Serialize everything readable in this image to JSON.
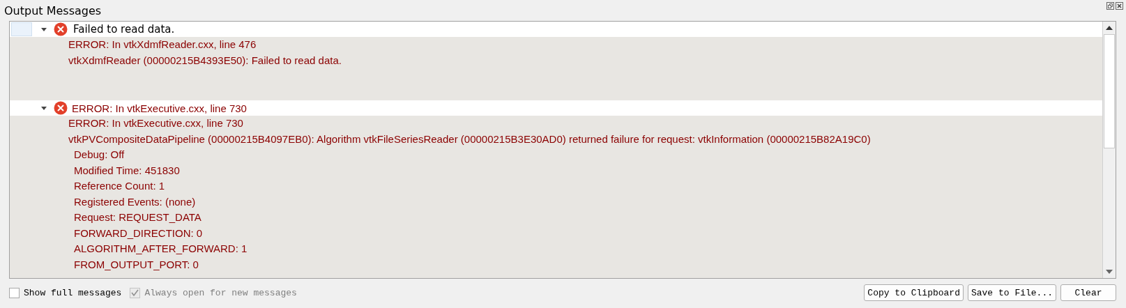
{
  "window": {
    "title": "Output Messages"
  },
  "messages": [
    {
      "title": "Failed to read data.",
      "expanded": true,
      "selected": true,
      "lines": [
        {
          "kind": "line",
          "text": "ERROR: In vtkXdmfReader.cxx, line 476"
        },
        {
          "kind": "line",
          "text": "vtkXdmfReader (00000215B4393E50): Failed to read data."
        }
      ]
    },
    {
      "title": "ERROR: In vtkExecutive.cxx, line 730",
      "expanded": true,
      "selected": false,
      "lines": [
        {
          "kind": "line",
          "text": "ERROR: In vtkExecutive.cxx, line 730"
        },
        {
          "kind": "line",
          "text": "vtkPVCompositeDataPipeline (00000215B4097EB0): Algorithm vtkFileSeriesReader (00000215B3E30AD0) returned failure for request: vtkInformation (00000215B82A19C0)"
        },
        {
          "kind": "property",
          "text": "Debug: Off"
        },
        {
          "kind": "property",
          "text": "Modified Time: 451830"
        },
        {
          "kind": "property",
          "text": "Reference Count: 1"
        },
        {
          "kind": "property",
          "text": "Registered Events: (none)"
        },
        {
          "kind": "property",
          "text": "Request: REQUEST_DATA"
        },
        {
          "kind": "property",
          "text": "FORWARD_DIRECTION: 0"
        },
        {
          "kind": "property",
          "text": "ALGORITHM_AFTER_FORWARD: 1"
        },
        {
          "kind": "property",
          "text": "FROM_OUTPUT_PORT: 0"
        }
      ]
    }
  ],
  "options": [
    {
      "label": "Show full messages",
      "checked": false,
      "disabled": false
    },
    {
      "label": "Always open for new messages",
      "checked": true,
      "disabled": true
    }
  ],
  "buttons": [
    "Copy to Clipboard",
    "Save to File...",
    "Clear"
  ]
}
